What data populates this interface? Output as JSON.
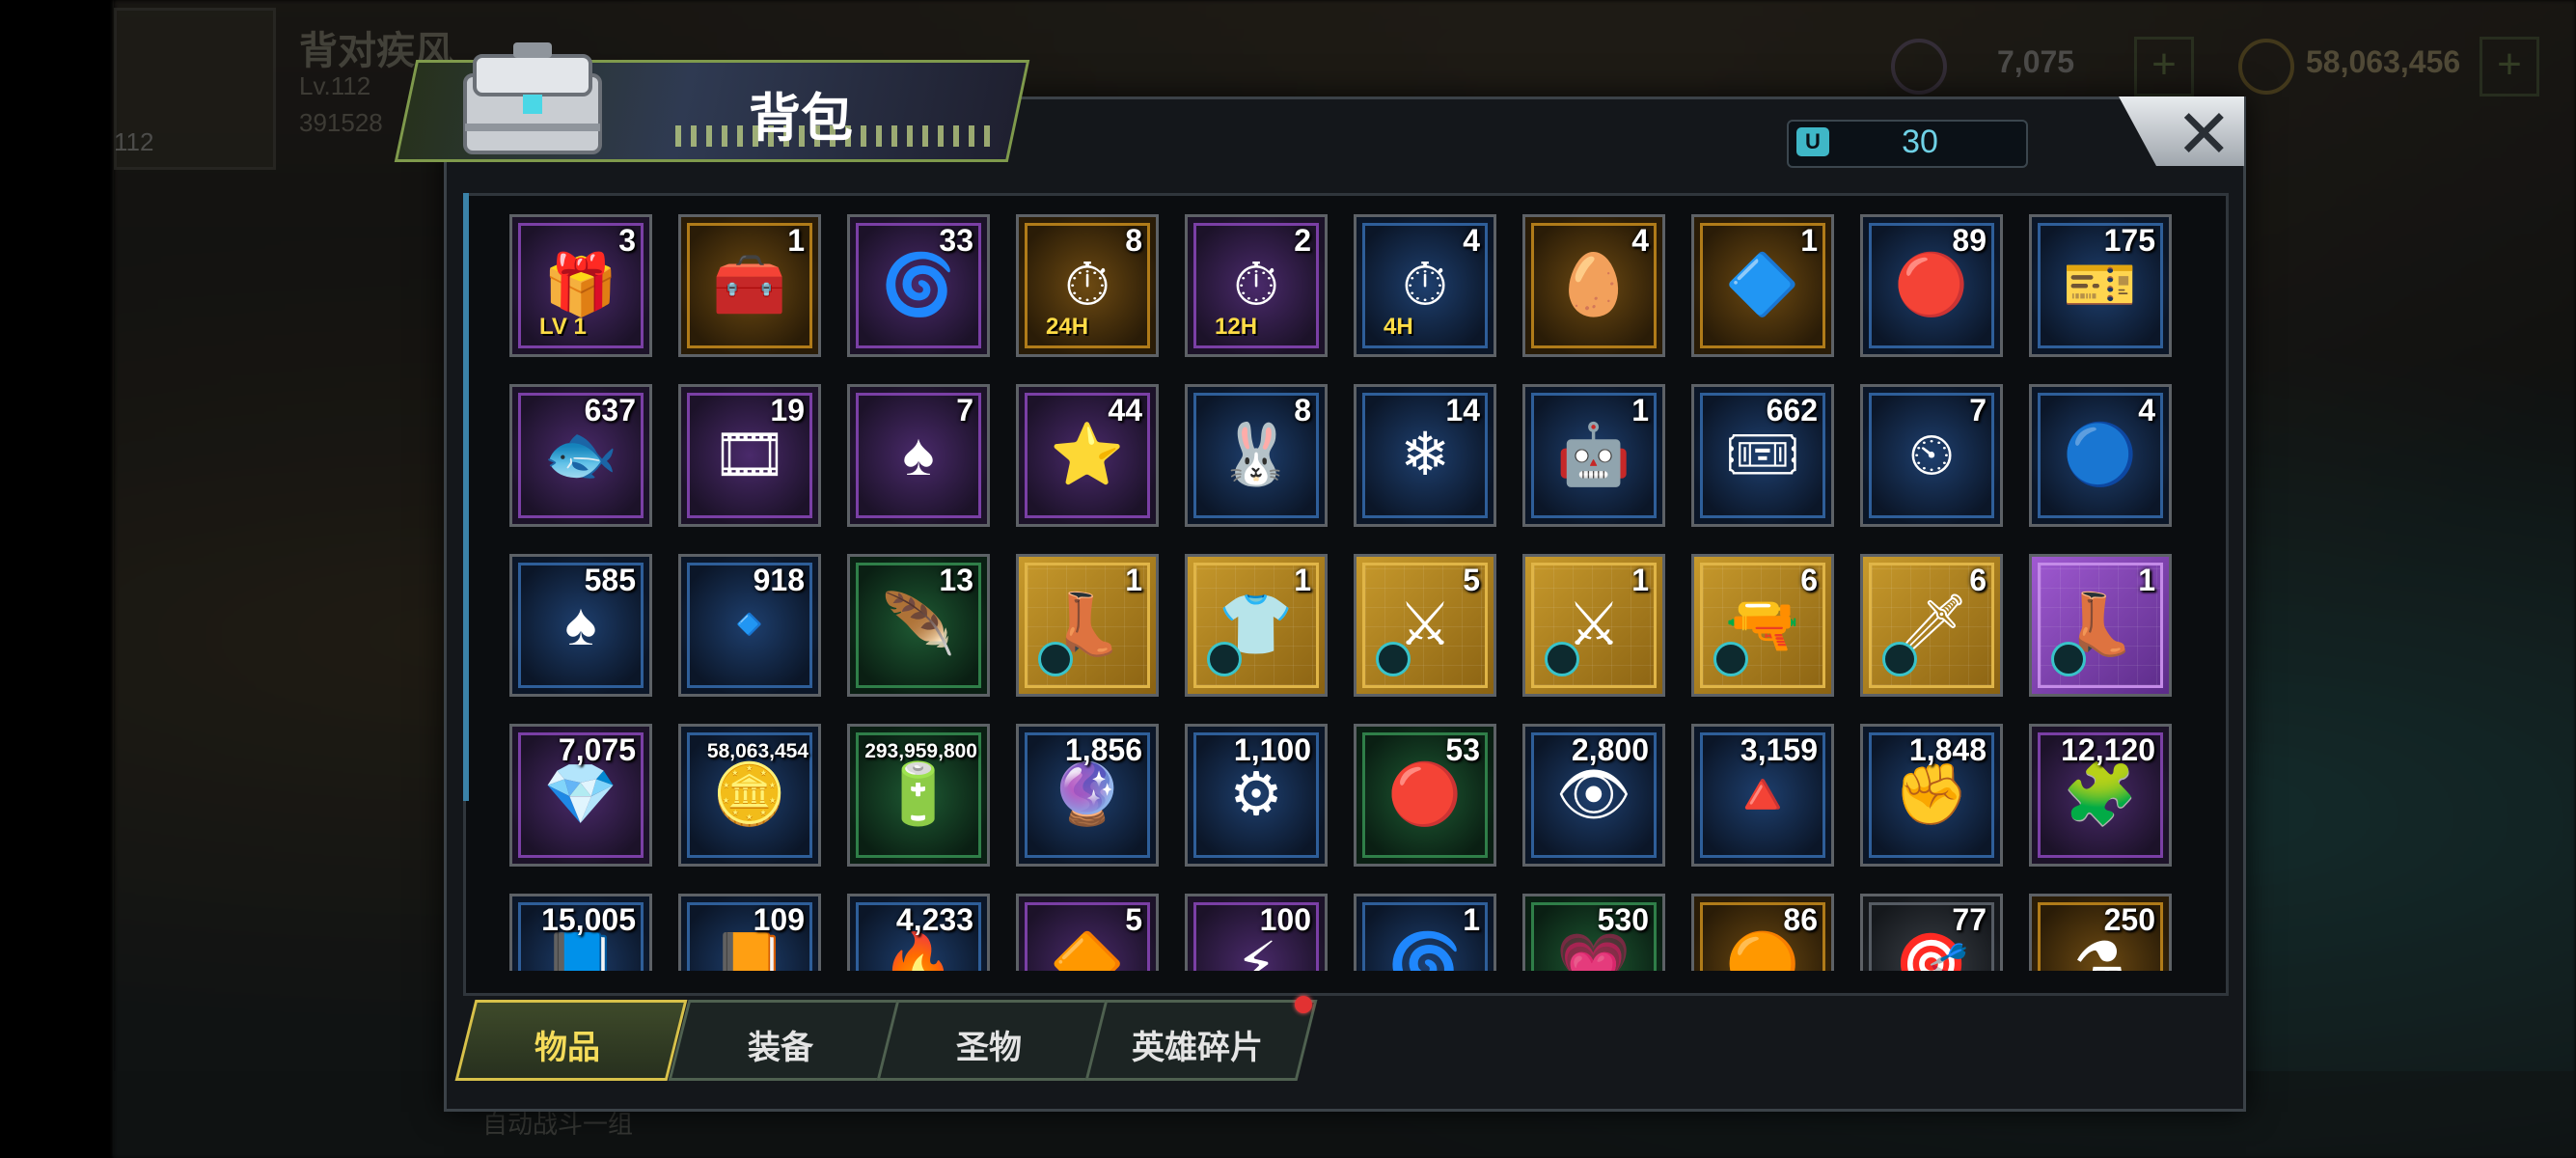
{
  "background_hud": {
    "player_name": "背对疾风",
    "level": "Lv.112",
    "avatar_level": "112",
    "power": "391528",
    "gems": "7,075",
    "gold": "58,063,456",
    "plus": "+",
    "chat_preview": "自动战斗一组"
  },
  "panel": {
    "title": "背包",
    "capacity_icon": "U",
    "capacity": "30",
    "close_label": "✕"
  },
  "tabs": [
    {
      "label": "物品",
      "active": true
    },
    {
      "label": "装备",
      "active": false
    },
    {
      "label": "圣物",
      "active": false
    },
    {
      "label": "英雄碎片",
      "active": false,
      "has_notification": true
    }
  ],
  "items": [
    {
      "count": "3",
      "icon": "treasure-chest-lv1",
      "rarity": "purple",
      "glyph": "🎁",
      "tag": "LV 1"
    },
    {
      "count": "1",
      "icon": "wooden-chest",
      "rarity": "gold",
      "glyph": "🧰"
    },
    {
      "count": "33",
      "icon": "teleport-device",
      "rarity": "purple",
      "glyph": "🌀"
    },
    {
      "count": "8",
      "icon": "speedup-24h",
      "rarity": "gold",
      "glyph": "⏱",
      "tag": "24H"
    },
    {
      "count": "2",
      "icon": "speedup-12h",
      "rarity": "purple",
      "glyph": "⏱",
      "tag": "12H"
    },
    {
      "count": "4",
      "icon": "speedup-4h",
      "rarity": "blue",
      "glyph": "⏱",
      "tag": "4H"
    },
    {
      "count": "4",
      "icon": "golden-egg",
      "rarity": "gold",
      "glyph": "🥚"
    },
    {
      "count": "1",
      "icon": "crystal-prism",
      "rarity": "gold",
      "glyph": "🔷"
    },
    {
      "count": "89",
      "icon": "red-bottle-cap",
      "rarity": "blue",
      "glyph": "🔴"
    },
    {
      "count": "175",
      "icon": "vip-ticket",
      "rarity": "blue",
      "glyph": "🎫"
    },
    {
      "count": "637",
      "icon": "fish",
      "rarity": "purple",
      "glyph": "🐟"
    },
    {
      "count": "19",
      "icon": "film-reel",
      "rarity": "purple",
      "glyph": "🎞"
    },
    {
      "count": "7",
      "icon": "poker-chip-purple",
      "rarity": "purple",
      "glyph": "♠"
    },
    {
      "count": "44",
      "icon": "police-badge",
      "rarity": "purple",
      "glyph": "⭐"
    },
    {
      "count": "8",
      "icon": "bunny-coin",
      "rarity": "blue",
      "glyph": "🐰"
    },
    {
      "count": "14",
      "icon": "snowball",
      "rarity": "blue",
      "glyph": "❄"
    },
    {
      "count": "1",
      "icon": "robot-coin",
      "rarity": "blue",
      "glyph": "🤖"
    },
    {
      "count": "662",
      "icon": "cinema-ticket",
      "rarity": "blue",
      "glyph": "🎟"
    },
    {
      "count": "7",
      "icon": "timer-clock",
      "rarity": "blue",
      "glyph": "⏲"
    },
    {
      "count": "4",
      "icon": "bottle-cap-blue",
      "rarity": "blue",
      "glyph": "🔵"
    },
    {
      "count": "585",
      "icon": "poker-chip-red",
      "rarity": "blue",
      "glyph": "♠"
    },
    {
      "count": "918",
      "icon": "bullet",
      "rarity": "blue",
      "glyph": "🔹"
    },
    {
      "count": "13",
      "icon": "feather",
      "rarity": "green",
      "glyph": "🪶"
    },
    {
      "count": "1",
      "icon": "boots-blueprint",
      "rarity": "card",
      "glyph": "👢"
    },
    {
      "count": "1",
      "icon": "shirt-blueprint",
      "rarity": "card",
      "glyph": "👕"
    },
    {
      "count": "5",
      "icon": "armor-blueprint",
      "rarity": "card",
      "glyph": "⚔"
    },
    {
      "count": "1",
      "icon": "helmet-blueprint",
      "rarity": "card",
      "glyph": "⚔"
    },
    {
      "count": "6",
      "icon": "pistol-blueprint",
      "rarity": "card",
      "glyph": "🔫"
    },
    {
      "count": "6",
      "icon": "sword-blueprint",
      "rarity": "card",
      "glyph": "🗡"
    },
    {
      "count": "1",
      "icon": "boots-blueprint-purple",
      "rarity": "card-purple",
      "glyph": "👢"
    },
    {
      "count": "7,075",
      "icon": "purple-gem",
      "rarity": "purple",
      "glyph": "💎"
    },
    {
      "count": "58,063,454",
      "icon": "gold-coins",
      "rarity": "blue",
      "glyph": "🪙",
      "small": true
    },
    {
      "count": "293,959,800",
      "icon": "green-battery",
      "rarity": "green",
      "glyph": "🔋",
      "small": true
    },
    {
      "count": "1,856",
      "icon": "purple-orb",
      "rarity": "blue",
      "glyph": "🔮"
    },
    {
      "count": "1,100",
      "icon": "gear",
      "rarity": "blue",
      "glyph": "⚙"
    },
    {
      "count": "53",
      "icon": "red-network-node",
      "rarity": "green",
      "glyph": "🔴"
    },
    {
      "count": "2,800",
      "icon": "eye-crystal",
      "rarity": "blue",
      "glyph": "👁"
    },
    {
      "count": "3,159",
      "icon": "triangle-crystal",
      "rarity": "blue",
      "glyph": "🔺"
    },
    {
      "count": "1,848",
      "icon": "fist-badge",
      "rarity": "blue",
      "glyph": "✊"
    },
    {
      "count": "12,120",
      "icon": "puzzle-piece",
      "rarity": "purple",
      "glyph": "🧩"
    },
    {
      "count": "15,005",
      "icon": "book-blue",
      "rarity": "blue",
      "glyph": "📘"
    },
    {
      "count": "109",
      "icon": "book-gold",
      "rarity": "blue",
      "glyph": "📙"
    },
    {
      "count": "4,233",
      "icon": "red-emblem",
      "rarity": "blue",
      "glyph": "🔥"
    },
    {
      "count": "5",
      "icon": "orange-crystal",
      "rarity": "purple",
      "glyph": "🔶"
    },
    {
      "count": "100",
      "icon": "lightning-coin",
      "rarity": "purple",
      "glyph": "⚡"
    },
    {
      "count": "1",
      "icon": "blue-propeller",
      "rarity": "blue",
      "glyph": "🌀"
    },
    {
      "count": "530",
      "icon": "pink-crystal",
      "rarity": "green",
      "glyph": "💗"
    },
    {
      "count": "86",
      "icon": "orange-fist",
      "rarity": "gold",
      "glyph": "🟠"
    },
    {
      "count": "77",
      "icon": "red-target",
      "rarity": "gray",
      "glyph": "🎯"
    },
    {
      "count": "250",
      "icon": "gold-flask",
      "rarity": "gold",
      "glyph": "⚗"
    }
  ]
}
